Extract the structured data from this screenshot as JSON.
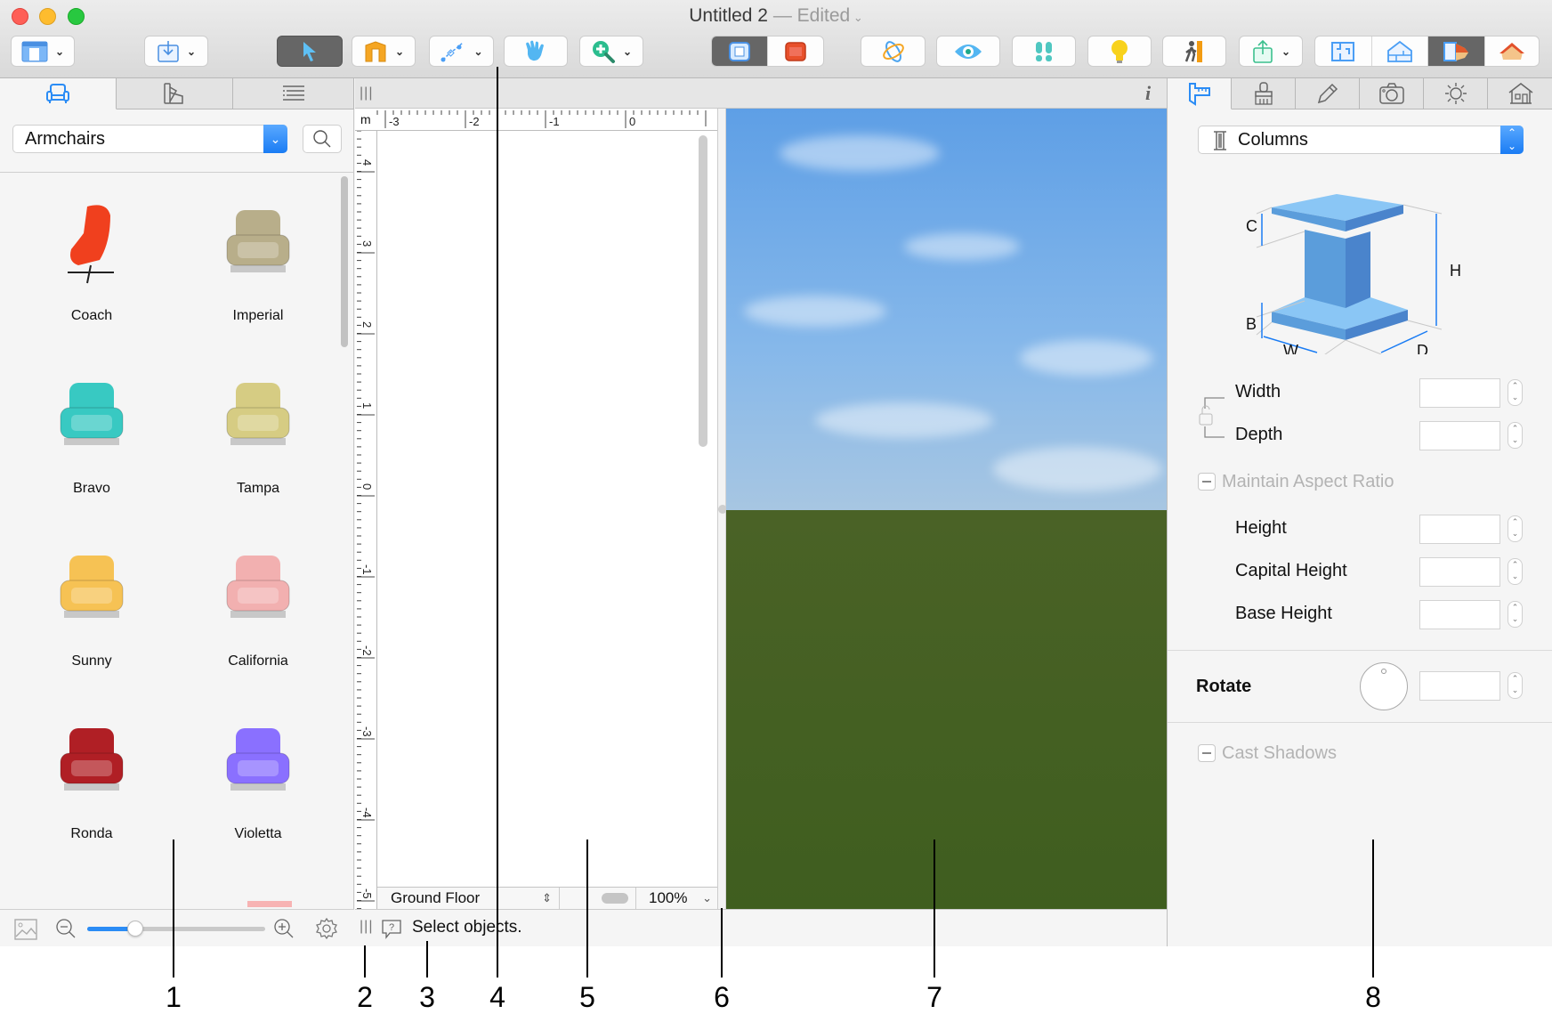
{
  "window": {
    "title": "Untitled 2",
    "title_sep": " — ",
    "status": "Edited",
    "traffic_colors": [
      "#fe5f57",
      "#febc2e",
      "#28c840"
    ]
  },
  "toolbar": {
    "groups": [
      {
        "name": "view-layout",
        "icon": "sidebar-layout-icon",
        "has_menu": true
      },
      {
        "name": "import",
        "icon": "import-icon",
        "has_menu": true
      },
      {
        "name": "select",
        "icon": "arrow-pointer-icon",
        "active": true
      },
      {
        "name": "walls",
        "icon": "walls-icon",
        "has_menu": true
      },
      {
        "name": "draw",
        "icon": "draw-path-icon",
        "has_menu": true
      },
      {
        "name": "pan",
        "icon": "hand-icon"
      },
      {
        "name": "zoom",
        "icon": "zoom-in-icon",
        "has_menu": true
      },
      {
        "name": "view-2d-3d",
        "icons": [
          "plan-view-icon",
          "3d-object-icon"
        ],
        "active_index": 0
      },
      {
        "name": "orbit",
        "icon": "orbit-icon"
      },
      {
        "name": "look",
        "icon": "eye-icon"
      },
      {
        "name": "walk",
        "icon": "footsteps-icon"
      },
      {
        "name": "light",
        "icon": "lightbulb-icon"
      },
      {
        "name": "walkthrough",
        "icon": "walkthrough-icon"
      },
      {
        "name": "share",
        "icon": "share-icon",
        "has_menu": true
      },
      {
        "name": "display-mode",
        "icons": [
          "floor-plan-icon",
          "elevation-icon",
          "split-view-icon",
          "3d-view-icon"
        ],
        "active_index": 2
      }
    ]
  },
  "library": {
    "tabs": [
      {
        "name": "furniture",
        "icon": "armchair-icon",
        "active": true
      },
      {
        "name": "materials",
        "icon": "swatches-icon"
      },
      {
        "name": "list",
        "icon": "list-icon"
      }
    ],
    "category": "Armchairs",
    "search_icon": "search-icon",
    "items": [
      {
        "label": "Coach",
        "color": "#f0401e"
      },
      {
        "label": "Imperial",
        "color": "#b8ae8a"
      },
      {
        "label": "Bravo",
        "color": "#38c9c2"
      },
      {
        "label": "Tampa",
        "color": "#d6cc83"
      },
      {
        "label": "Sunny",
        "color": "#f6c254"
      },
      {
        "label": "California",
        "color": "#f2b0b0"
      },
      {
        "label": "Ronda",
        "color": "#b01f25"
      },
      {
        "label": "Violetta",
        "color": "#8a70ff"
      }
    ],
    "thumb_size_fraction": 0.27
  },
  "plan": {
    "unit": "m",
    "h_ticks": [
      "-3",
      "-2",
      "-1",
      "0"
    ],
    "v_ticks": [
      "4",
      "3",
      "2",
      "1",
      "0",
      "-1",
      "-2",
      "-3",
      "-4",
      "-5"
    ],
    "floor": "Ground Floor",
    "zoom": "100%",
    "info_icon": "i"
  },
  "status": {
    "message": "Select objects."
  },
  "inspector": {
    "tabs": [
      {
        "name": "dimensions",
        "icon": "caliper-icon",
        "active": true
      },
      {
        "name": "materials",
        "icon": "paintbrush-icon"
      },
      {
        "name": "edit",
        "icon": "pencil-icon"
      },
      {
        "name": "camera",
        "icon": "camera-icon"
      },
      {
        "name": "light",
        "icon": "sun-icon"
      },
      {
        "name": "building",
        "icon": "house-icon"
      }
    ],
    "object_type": "Columns",
    "diagram_labels": {
      "c": "C",
      "h": "H",
      "b": "B",
      "w": "W",
      "d": "D"
    },
    "fields": {
      "width": {
        "label": "Width",
        "value": ""
      },
      "depth": {
        "label": "Depth",
        "value": ""
      },
      "height": {
        "label": "Height",
        "value": ""
      },
      "capital_height": {
        "label": "Capital Height",
        "value": ""
      },
      "base_height": {
        "label": "Base Height",
        "value": ""
      }
    },
    "maintain_aspect": "Maintain Aspect Ratio",
    "rotate": {
      "label": "Rotate",
      "value": ""
    },
    "cast_shadows": "Cast Shadows",
    "accent": "#1a7cf4"
  },
  "callouts": [
    "1",
    "2",
    "3",
    "4",
    "5",
    "6",
    "7",
    "8"
  ]
}
